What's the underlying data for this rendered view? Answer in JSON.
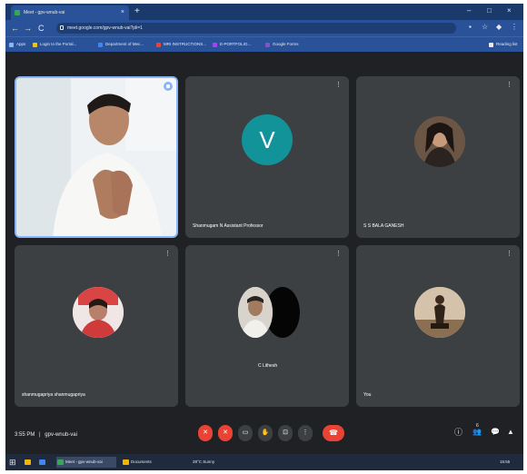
{
  "browser": {
    "tab_title": "Meet - gpv-wnub-vai",
    "tab_close": "×",
    "new_tab": "+",
    "window_controls": [
      "–",
      "□",
      "×"
    ],
    "nav": {
      "back": "←",
      "forward": "→",
      "reload": "C"
    },
    "url": "meet.google.com/gpv-wnub-vai?pli=1",
    "reading_list": "Reading list",
    "bookmarks": [
      {
        "label": "Apps",
        "color": "#8ab4f8"
      },
      {
        "label": "Login to the Portal...",
        "color": "#f1c40f"
      },
      {
        "label": "Department of Mec...",
        "color": "#4285f4"
      },
      {
        "label": "MRI INSTRUCTIONS...",
        "color": "#ea4335"
      },
      {
        "label": "E-PORTFOLIO...",
        "color": "#a142f4"
      },
      {
        "label": "Google Forms",
        "color": "#7e57c2"
      }
    ]
  },
  "meeting": {
    "time": "3:55 PM",
    "separator": "|",
    "code": "gpv-wnub-vai",
    "participants": [
      {
        "name": "",
        "kind": "video"
      },
      {
        "name": "Shanmugam N Assistant Professor",
        "kind": "letter",
        "letter": "V",
        "color": "#12939a"
      },
      {
        "name": "S S BALA GANESH",
        "kind": "photo"
      },
      {
        "name": "shanmugapriya shanmugapriya",
        "kind": "photo"
      },
      {
        "name": "C Lithesh",
        "kind": "photo"
      },
      {
        "name": "You",
        "kind": "photo"
      }
    ],
    "more_glyph": "⋮",
    "controls": [
      "mic-off",
      "camera-off",
      "captions",
      "raise-hand",
      "present",
      "more-options",
      "end-call"
    ],
    "control_glyphs": {
      "mic": "✕",
      "cam": "✕",
      "cc": "▭",
      "hand": "✋",
      "present": "⊡",
      "more": "⋮",
      "end": "☎"
    },
    "right_controls": {
      "info": "ⓘ",
      "people": "👥",
      "chat": "💬",
      "activities": "▲"
    },
    "people_count": "6"
  },
  "taskbar": {
    "start": "⊞",
    "items": [
      {
        "label": "",
        "color": "#f4b400"
      },
      {
        "label": "",
        "color": "#4285f4"
      },
      {
        "label": "Meet - gpv-wnub-vai",
        "color": "#34a853",
        "active": true
      },
      {
        "label": "Documents",
        "color": "#f4b400",
        "active": false
      }
    ],
    "weather": "28°C Sunny",
    "time": "15:55"
  }
}
